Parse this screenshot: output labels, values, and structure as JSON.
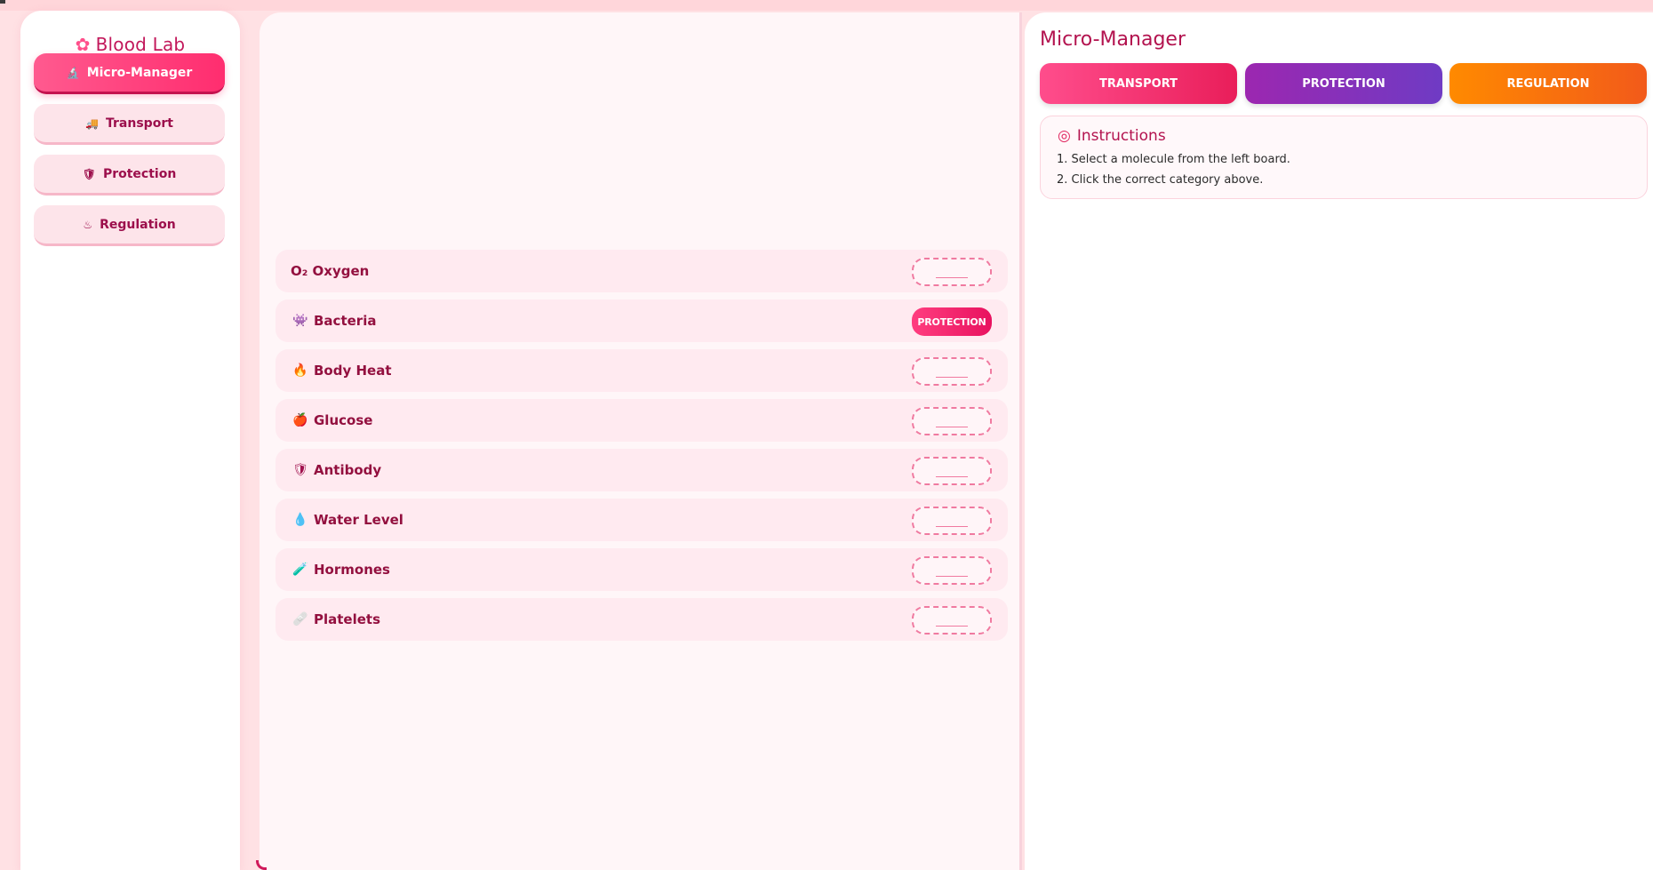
{
  "sidebar": {
    "brand": {
      "icon": "flower-icon",
      "glyph": "✿",
      "title": "Blood Lab"
    },
    "items": [
      {
        "label": "Micro-Manager",
        "icon": "microscope-icon",
        "glyph": "🔬",
        "active": true
      },
      {
        "label": "Transport",
        "icon": "truck-icon",
        "glyph": "🚚",
        "active": false
      },
      {
        "label": "Protection",
        "icon": "shield-icon",
        "glyph": "🛡",
        "active": false
      },
      {
        "label": "Regulation",
        "icon": "thermostat-icon",
        "glyph": "♨",
        "active": false
      }
    ]
  },
  "board": {
    "rows": [
      {
        "name": "O₂ Oxygen",
        "icon": "",
        "glyph": "",
        "assigned": ""
      },
      {
        "name": "Bacteria",
        "icon": "alien-monster-icon",
        "glyph": "👾",
        "assigned": "PROTECTION"
      },
      {
        "name": "Body Heat",
        "icon": "fire-icon",
        "glyph": "🔥",
        "assigned": ""
      },
      {
        "name": "Glucose",
        "icon": "apple-icon",
        "glyph": "🍎",
        "assigned": ""
      },
      {
        "name": "Antibody",
        "icon": "shield-icon",
        "glyph": "🛡",
        "assigned": ""
      },
      {
        "name": "Water Level",
        "icon": "droplet-icon",
        "glyph": "💧",
        "assigned": ""
      },
      {
        "name": "Hormones",
        "icon": "test-tube-icon",
        "glyph": "🧪",
        "assigned": ""
      },
      {
        "name": "Platelets",
        "icon": "bandage-icon",
        "glyph": "🩹",
        "assigned": ""
      }
    ]
  },
  "panel": {
    "title": "Micro-Manager",
    "categories": [
      {
        "label": "TRANSPORT",
        "color": "#ff4d8c"
      },
      {
        "label": "PROTECTION",
        "color": "#9c27b0"
      },
      {
        "label": "REGULATION",
        "color": "#ff8a00"
      }
    ],
    "instructions": {
      "icon": "target-icon",
      "glyph": "◎",
      "title": "Instructions",
      "lines": [
        "1. Select a molecule from the left board.",
        "2. Click the correct category above."
      ]
    }
  }
}
